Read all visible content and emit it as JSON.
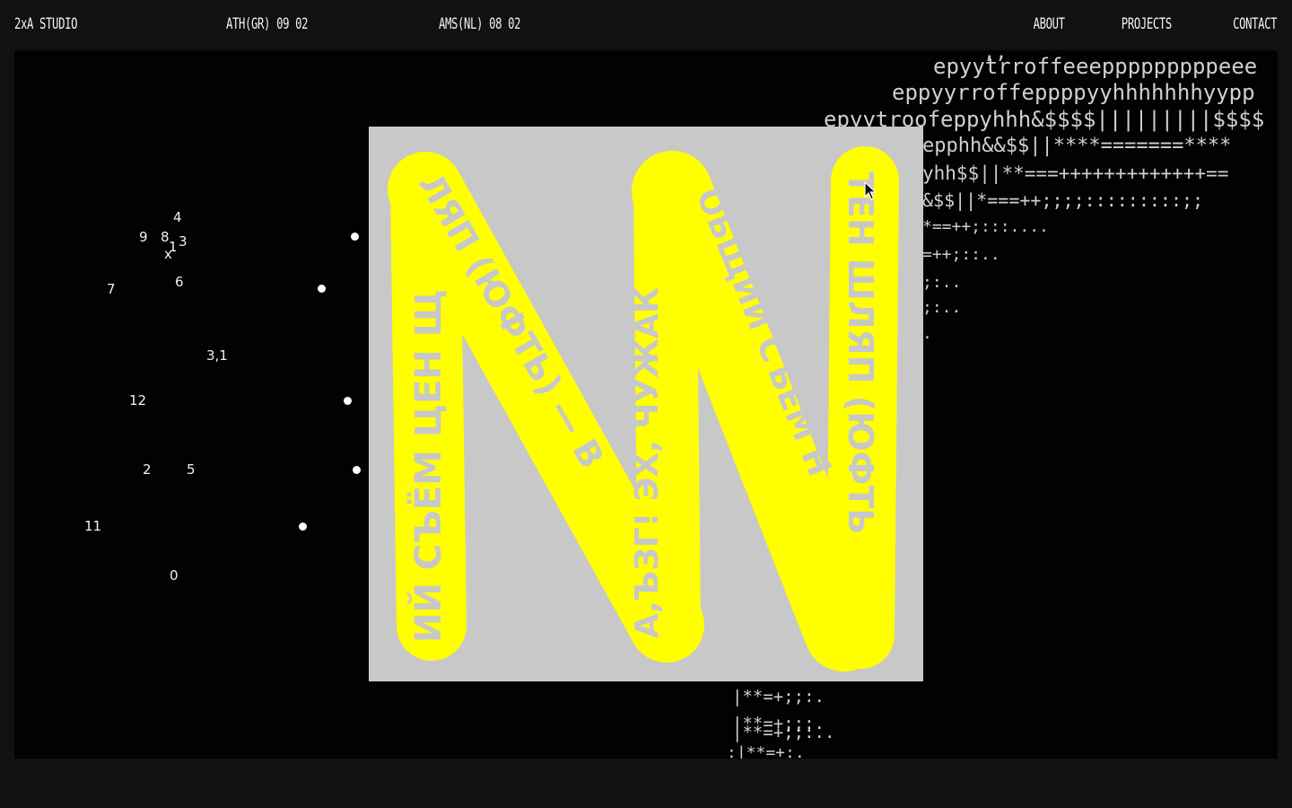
{
  "header": {
    "brand": "2xA STUDIO",
    "location_1": "ATH(GR) 09 02",
    "location_2": "AMS(NL) 08 02",
    "nav": [
      "ABOUT",
      "PROJECTS",
      "CONTACT"
    ]
  },
  "graph": {
    "labels": [
      "4",
      "9",
      "8",
      "1",
      "3",
      "x",
      "6",
      "7",
      "3,1",
      "12",
      "2",
      "5",
      "11",
      "0"
    ]
  },
  "ascii_art": [
    ",,",
    "epyytrroffeeepppppppppeee",
    "eppyyrroffeppppyyhhhhhhhyypp",
    "epyytroofeppyhhh&$$$$|||||||||$$$$",
    "epphh&&$$||****=======****",
    "yhh$$||**===+++++++++++++==",
    "&$$||*===++;;;;:::::::::;;",
    "*==++;:::....",
    "=++;::..",
    ";:..",
    ";:..",
    ".",
    "|**=+;;:.",
    "|**=+;;:.",
    "|**=+;;:..",
    ":|**=+:."
  ],
  "poster": {
    "letter_text": {
      "left_stroke": "ИЙ СЪЁМ ЦЕН Щ",
      "diagonal_1": "ЛЯП (ЮФТЬ) — В",
      "middle_stroke": "А,ЪЗГ! ЭХ, ЧУЖАК",
      "diagonal_2": "ОБЩИЙ СЪЁМ Н",
      "right_stroke": "ТЕН ШЛЯП (ЮФТЬ"
    },
    "colors": {
      "background": "#c8c8c8",
      "letter": "#ffff00",
      "text": "#c8c8c8"
    }
  },
  "icons": {
    "cursor": "arrow-cursor-icon"
  }
}
